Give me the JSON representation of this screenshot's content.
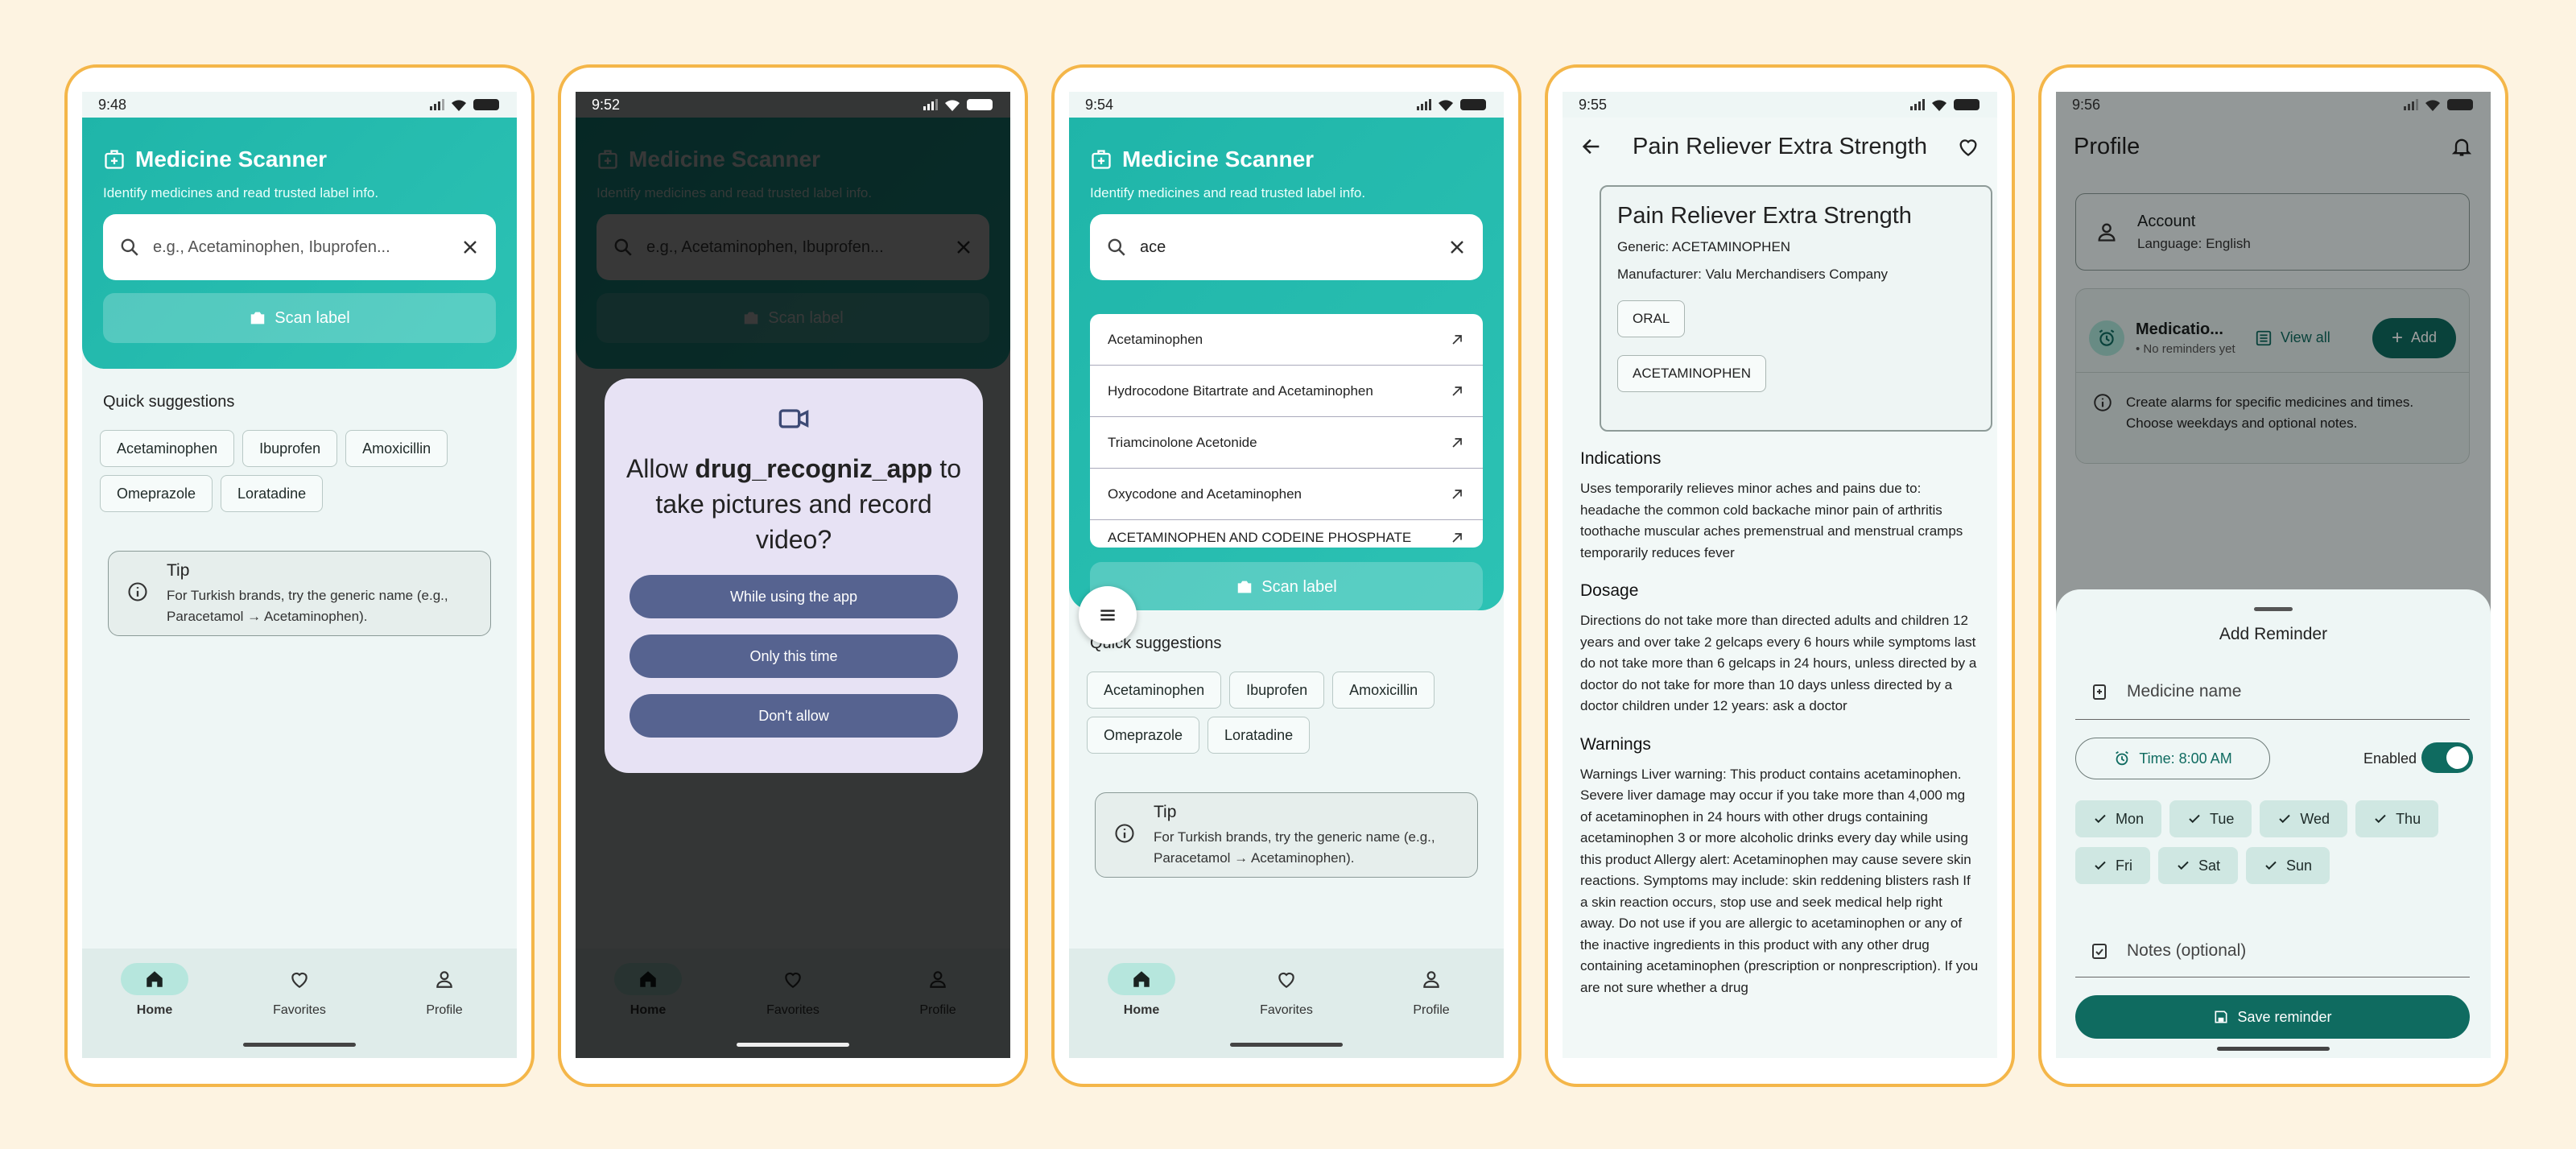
{
  "colors": {
    "background": "#fdf3e1",
    "frame": "#f4b649",
    "primary": "#1fb5a9",
    "dark_primary": "#0f6b60",
    "dialog_button": "#566390"
  },
  "screen1": {
    "time": "9:48",
    "app_title": "Medicine Scanner",
    "subtitle": "Identify medicines and read trusted label info.",
    "search_placeholder": "e.g., Acetaminophen, Ibuprofen...",
    "scan_label": "Scan label",
    "quick_title": "Quick suggestions",
    "chips": [
      "Acetaminophen",
      "Ibuprofen",
      "Amoxicillin",
      "Omeprazole",
      "Loratadine"
    ],
    "tip_title": "Tip",
    "tip_text": "For Turkish brands, try the generic name (e.g., Paracetamol → Acetaminophen).",
    "nav": [
      "Home",
      "Favorites",
      "Profile"
    ]
  },
  "screen2": {
    "time": "9:52",
    "dialog_prefix": "Allow ",
    "dialog_app": "drug_recogniz_app",
    "dialog_suffix": "to take pictures and record video?",
    "buttons": [
      "While using the app",
      "Only this time",
      "Don't allow"
    ]
  },
  "screen3": {
    "time": "9:54",
    "search_value": "ace",
    "results": [
      "Acetaminophen",
      "Hydrocodone Bitartrate and Acetaminophen",
      "Triamcinolone Acetonide",
      "Oxycodone and Acetaminophen",
      "ACETAMINOPHEN AND CODEINE PHOSPHATE"
    ]
  },
  "screen4": {
    "time": "9:55",
    "title": "Pain Reliever Extra Strength",
    "generic": "Generic: ACETAMINOPHEN",
    "manufacturer": "Manufacturer: Valu Merchandisers Company",
    "route": "ORAL",
    "ingredient": "ACETAMINOPHEN",
    "indications_title": "Indications",
    "indications": "Uses temporarily relieves minor aches and pains due to: headache the common cold backache minor pain of arthritis toothache muscular aches premenstrual and menstrual cramps temporarily reduces fever",
    "dosage_title": "Dosage",
    "dosage": "Directions do not take more than directed adults and children 12 years and over take 2 gelcaps every 6 hours while symptoms last do not take more than 6 gelcaps in 24 hours, unless directed by a doctor do not take for more than 10 days unless directed by a doctor children under 12 years: ask a doctor",
    "warnings_title": "Warnings",
    "warnings": "Warnings Liver warning: This product contains acetaminophen. Severe liver damage may occur if you take more than 4,000 mg of acetaminophen in 24 hours with other drugs containing acetaminophen 3 or more alcoholic drinks every day while using this product Allergy alert: Acetaminophen may cause severe skin reactions. Symptoms may include: skin reddening blisters rash If a skin reaction occurs, stop use and seek medical help right away. Do not use if you are allergic to acetaminophen or any of the inactive ingredients in this product with any other drug containing acetaminophen (prescription or nonprescription). If you are not sure whether a drug"
  },
  "screen5": {
    "time": "9:56",
    "title": "Profile",
    "account_title": "Account",
    "account_sub": "Language: English",
    "med_title": "Medicatio...",
    "med_sub": "• No reminders yet",
    "view_all": "View all",
    "add": "Add",
    "alarm_info": "Create alarms for specific medicines and times. Choose weekdays and optional notes.",
    "sheet_title": "Add Reminder",
    "medicine_name": "Medicine name",
    "time_label": "Time: 8:00 AM",
    "enabled_label": "Enabled",
    "enabled": true,
    "days": [
      "Mon",
      "Tue",
      "Wed",
      "Thu",
      "Fri",
      "Sat",
      "Sun"
    ],
    "notes": "Notes (optional)",
    "save": "Save reminder"
  }
}
